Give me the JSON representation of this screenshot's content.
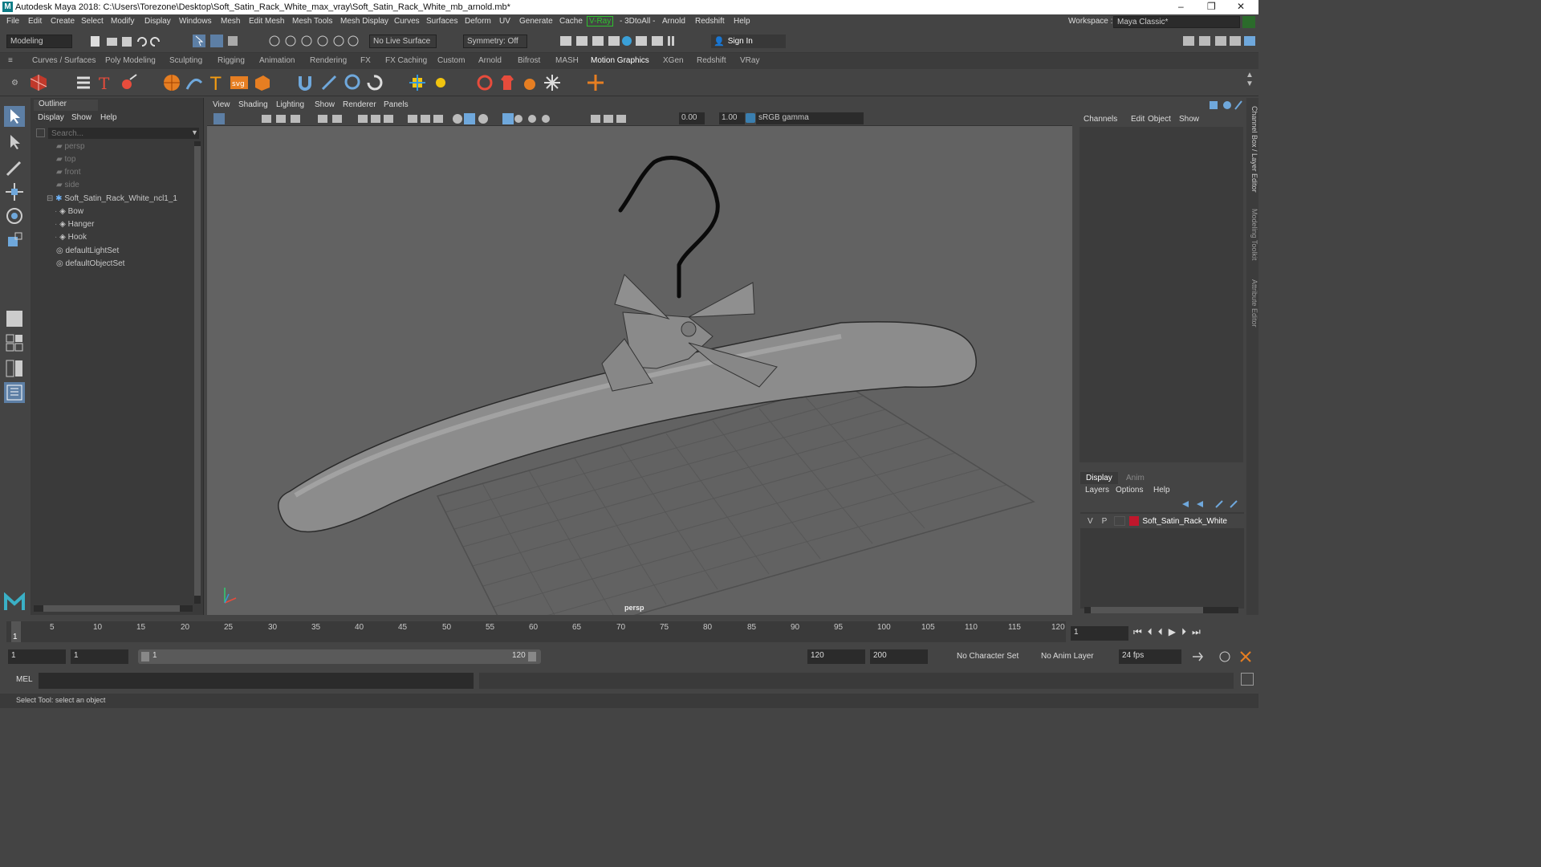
{
  "window": {
    "title": "Autodesk Maya 2018: C:\\Users\\Torezone\\Desktop\\Soft_Satin_Rack_White_max_vray\\Soft_Satin_Rack_White_mb_arnold.mb*",
    "minimize": "–",
    "maximize": "❐",
    "close": "✕"
  },
  "menu": {
    "items": [
      "File",
      "Edit",
      "Create",
      "Select",
      "Modify",
      "Display",
      "Windows",
      "Mesh",
      "Edit Mesh",
      "Mesh Tools",
      "Mesh Display",
      "Curves",
      "Surfaces",
      "Deform",
      "UV",
      "Generate",
      "Cache",
      "V-Ray",
      "- 3DtoAll -",
      "Arnold",
      "Redshift",
      "Help"
    ],
    "workspace_label": "Workspace :",
    "workspace_value": "Maya Classic*"
  },
  "status": {
    "mode": "Modeling",
    "live_surface": "No Live Surface",
    "symmetry": "Symmetry: Off",
    "sign_in": "Sign In"
  },
  "shelf": {
    "tabs": [
      "Curves / Surfaces",
      "Poly Modeling",
      "Sculpting",
      "Rigging",
      "Animation",
      "Rendering",
      "FX",
      "FX Caching",
      "Custom",
      "Arnold",
      "Bifrost",
      "MASH",
      "Motion Graphics",
      "XGen",
      "Redshift",
      "VRay"
    ],
    "active": "Motion Graphics"
  },
  "outliner": {
    "title": "Outliner",
    "menu": [
      "Display",
      "Show",
      "Help"
    ],
    "search_placeholder": "Search...",
    "items": [
      {
        "label": "persp",
        "dim": true
      },
      {
        "label": "top",
        "dim": true
      },
      {
        "label": "front",
        "dim": true
      },
      {
        "label": "side",
        "dim": true
      },
      {
        "label": "Soft_Satin_Rack_White_ncl1_1",
        "dim": false
      },
      {
        "label": "Bow",
        "dim": false
      },
      {
        "label": "Hanger",
        "dim": false
      },
      {
        "label": "Hook",
        "dim": false
      },
      {
        "label": "defaultLightSet",
        "dim": false
      },
      {
        "label": "defaultObjectSet",
        "dim": false
      }
    ]
  },
  "viewport": {
    "menu": [
      "View",
      "Shading",
      "Lighting",
      "Show",
      "Renderer",
      "Panels"
    ],
    "exposure": "0.00",
    "gamma": "1.00",
    "color_space": "sRGB gamma",
    "camera_label": "persp"
  },
  "channel_box": {
    "menu": [
      "Channels",
      "Edit",
      "Object",
      "Show"
    ],
    "side_tabs": [
      "Channel Box / Layer Editor",
      "Modeling Toolkit",
      "Attribute Editor"
    ]
  },
  "layer_editor": {
    "tabs": [
      "Display",
      "Anim"
    ],
    "menu": [
      "Layers",
      "Options",
      "Help"
    ],
    "layer": {
      "v": "V",
      "p": "P",
      "name": "Soft_Satin_Rack_White",
      "color": "#c0172c"
    }
  },
  "timeline": {
    "ticks": [
      "1",
      "5",
      "10",
      "15",
      "20",
      "25",
      "30",
      "35",
      "40",
      "45",
      "50",
      "55",
      "60",
      "65",
      "70",
      "75",
      "80",
      "85",
      "90",
      "95",
      "100",
      "105",
      "110",
      "115",
      "120"
    ],
    "current_frame": "1"
  },
  "range": {
    "start": "1",
    "playback_start": "1",
    "slider_start": "1",
    "slider_end": "120",
    "playback_end": "120",
    "end": "200",
    "character_set": "No Character Set",
    "anim_layer": "No Anim Layer",
    "fps": "24 fps"
  },
  "command": {
    "lang": "MEL"
  },
  "help_line": "Select Tool: select an object"
}
